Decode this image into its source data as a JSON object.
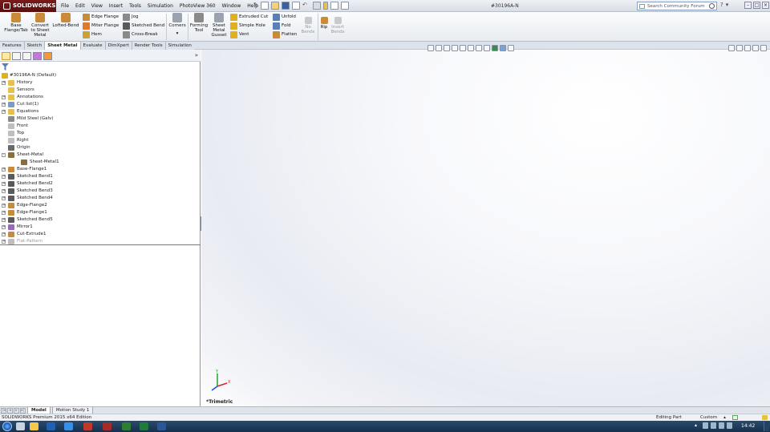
{
  "app": {
    "name": "SOLIDWORKS",
    "document_title": "#30196A-N"
  },
  "menus": [
    "File",
    "Edit",
    "View",
    "Insert",
    "Tools",
    "Simulation",
    "PhotoView 360",
    "Window",
    "Help"
  ],
  "search": {
    "placeholder": "Search Community Forum"
  },
  "ribbon": {
    "big_buttons": [
      {
        "label": "Base Flange/Tab",
        "icon": "base-flange-icon"
      },
      {
        "label": "Convert to Sheet Metal",
        "icon": "convert-sheet-metal-icon"
      },
      {
        "label": "Lofted-Bend",
        "icon": "lofted-bend-icon"
      }
    ],
    "group1": [
      {
        "label": "Edge Flange",
        "icon": "edge-flange-icon"
      },
      {
        "label": "Miter Flange",
        "icon": "miter-flange-icon"
      },
      {
        "label": "Hem",
        "icon": "hem-icon"
      }
    ],
    "group2": [
      {
        "label": "Jog",
        "icon": "jog-icon"
      },
      {
        "label": "Sketched Bend",
        "icon": "sketched-bend-icon"
      },
      {
        "label": "Cross-Break",
        "icon": "cross-break-icon"
      }
    ],
    "corners": {
      "label": "Corners",
      "icon": "corners-icon"
    },
    "forming_tool": {
      "label": "Forming Tool",
      "icon": "forming-tool-icon"
    },
    "gusset": {
      "label": "Sheet Metal Gusset",
      "icon": "gusset-icon"
    },
    "group3": [
      {
        "label": "Extruded Cut",
        "icon": "extruded-cut-icon"
      },
      {
        "label": "Simple Hole",
        "icon": "simple-hole-icon"
      },
      {
        "label": "Vent",
        "icon": "vent-icon"
      }
    ],
    "group4": [
      {
        "label": "Unfold",
        "icon": "unfold-icon"
      },
      {
        "label": "Fold",
        "icon": "fold-icon"
      },
      {
        "label": "Flatten",
        "icon": "flatten-icon"
      }
    ],
    "no_bends": {
      "label": "No Bends",
      "icon": "no-bends-icon"
    },
    "rip": {
      "label": "Rip",
      "icon": "rip-icon"
    },
    "insert_bends": {
      "label": "Insert Bends",
      "icon": "insert-bends-icon"
    }
  },
  "tabs": [
    "Features",
    "Sketch",
    "Sheet Metal",
    "Evaluate",
    "DimXpert",
    "Render Tools",
    "Simulation"
  ],
  "active_tab": "Sheet Metal",
  "tree": {
    "root": "#30196A-N  (Default)",
    "items": [
      {
        "label": "History",
        "indent": 1,
        "exp": "+",
        "icon": "history-icon",
        "color": "#e6c04a"
      },
      {
        "label": "Sensors",
        "indent": 1,
        "exp": "",
        "icon": "sensors-icon",
        "color": "#e6c04a"
      },
      {
        "label": "Annotations",
        "indent": 1,
        "exp": "+",
        "icon": "annotations-icon",
        "color": "#e6c04a"
      },
      {
        "label": "Cut list(1)",
        "indent": 1,
        "exp": "+",
        "icon": "cut-list-icon",
        "color": "#7a9bc6"
      },
      {
        "label": "Equations",
        "indent": 1,
        "exp": "+",
        "icon": "equations-icon",
        "color": "#e6c04a"
      },
      {
        "label": "Mild Steel (Galv)",
        "indent": 1,
        "exp": "",
        "icon": "material-icon",
        "color": "#8a8a8a"
      },
      {
        "label": "Front",
        "indent": 1,
        "exp": "",
        "icon": "plane-icon",
        "color": "#bfbfbf"
      },
      {
        "label": "Top",
        "indent": 1,
        "exp": "",
        "icon": "plane-icon",
        "color": "#bfbfbf"
      },
      {
        "label": "Right",
        "indent": 1,
        "exp": "",
        "icon": "plane-icon",
        "color": "#bfbfbf"
      },
      {
        "label": "Origin",
        "indent": 1,
        "exp": "",
        "icon": "origin-icon",
        "color": "#6a6a6a"
      },
      {
        "label": "Sheet-Metal",
        "indent": 1,
        "exp": "-",
        "icon": "sheet-metal-icon",
        "color": "#8a6e3c"
      },
      {
        "label": "Sheet-Metal1",
        "indent": 2,
        "exp": "",
        "icon": "sheet-metal-feature-icon",
        "color": "#8a6e3c"
      },
      {
        "label": "Base-Flange1",
        "indent": 1,
        "exp": "+",
        "icon": "base-flange-feature-icon",
        "color": "#c98a3a"
      },
      {
        "label": "Sketched Bend1",
        "indent": 1,
        "exp": "+",
        "icon": "sketched-bend-feature-icon",
        "color": "#5a5a5a"
      },
      {
        "label": "Sketched Bend2",
        "indent": 1,
        "exp": "+",
        "icon": "sketched-bend-feature-icon",
        "color": "#5a5a5a"
      },
      {
        "label": "Sketched Bend3",
        "indent": 1,
        "exp": "+",
        "icon": "sketched-bend-feature-icon",
        "color": "#5a5a5a"
      },
      {
        "label": "Sketched Bend4",
        "indent": 1,
        "exp": "+",
        "icon": "sketched-bend-feature-icon",
        "color": "#5a5a5a"
      },
      {
        "label": "Edge-Flange2",
        "indent": 1,
        "exp": "+",
        "icon": "edge-flange-feature-icon",
        "color": "#c98a3a"
      },
      {
        "label": "Edge-Flange1",
        "indent": 1,
        "exp": "+",
        "icon": "edge-flange-feature-icon",
        "color": "#c98a3a"
      },
      {
        "label": "Sketched Bend5",
        "indent": 1,
        "exp": "+",
        "icon": "sketched-bend-feature-icon",
        "color": "#5a5a5a"
      },
      {
        "label": "Mirror1",
        "indent": 1,
        "exp": "+",
        "icon": "mirror-icon",
        "color": "#9a6ab8"
      },
      {
        "label": "Cut-Extrude1",
        "indent": 1,
        "exp": "+",
        "icon": "cut-extrude-icon",
        "color": "#c98a3a"
      },
      {
        "label": "Flat-Pattern",
        "indent": 1,
        "exp": "+",
        "icon": "flat-pattern-icon",
        "color": "#bfbfbf",
        "suppressed": true
      }
    ]
  },
  "viewport": {
    "view_name": "*Trimetric"
  },
  "bottom_tabs": [
    "Model",
    "Motion Study 1"
  ],
  "status": {
    "edition": "SOLIDWORKS Premium 2015 x64 Edition",
    "mode": "Editing Part",
    "units": "Custom"
  },
  "taskbar": {
    "time": "14:42"
  },
  "colors": {
    "accent": "#7a1a1a",
    "selection": "#ffe9a6"
  }
}
